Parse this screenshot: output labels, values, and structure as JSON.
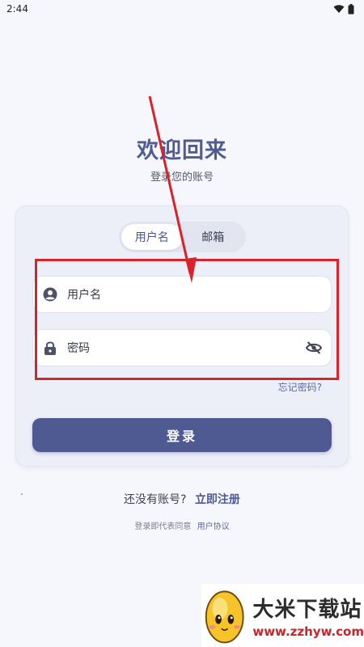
{
  "status_bar": {
    "time": "2:44",
    "icons": [
      "wifi-icon",
      "battery-icon"
    ]
  },
  "header": {
    "title": "欢迎回来",
    "subtitle": "登录您的账号"
  },
  "login_tabs": {
    "items": [
      {
        "label": "用户名",
        "selected": true
      },
      {
        "label": "邮箱",
        "selected": false
      }
    ]
  },
  "form": {
    "username_placeholder": "用户名",
    "password_placeholder": "密码",
    "username_icon": "account-circle-icon",
    "password_icon": "lock-icon",
    "visibility_icon": "visibility-off-icon",
    "forgot_label": "忘记密码?",
    "login_label": "登录"
  },
  "footer": {
    "no_account_text": "还没有账号?",
    "register_label": "立即注册",
    "agree_text": "登录即代表同意",
    "agreement_label": "用户协议"
  },
  "watermark": {
    "name": "大米下载站",
    "url": "www.zzhyw.com"
  },
  "colors": {
    "accent": "#4f5a93",
    "title": "#515b8f",
    "annotation": "#d9232b",
    "background": "#f6f7fc",
    "card": "#eceef8"
  }
}
